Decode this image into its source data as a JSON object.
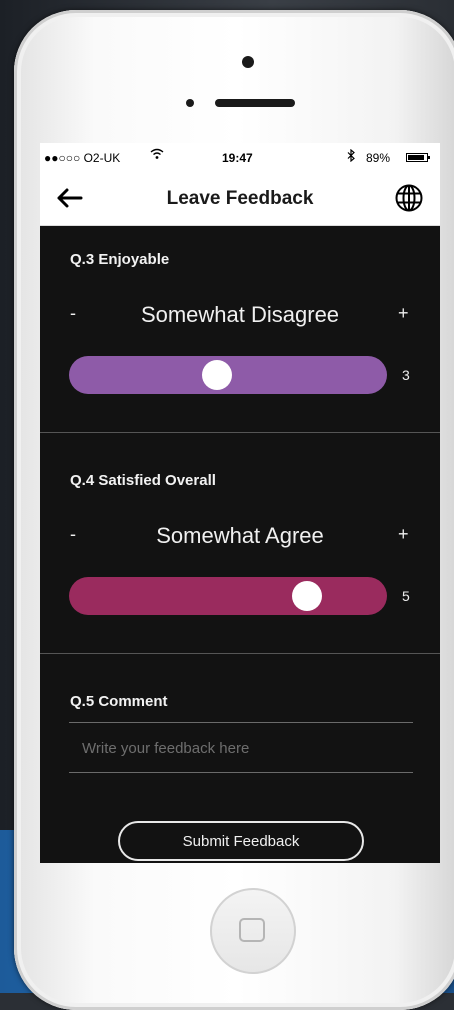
{
  "status_bar": {
    "carrier": "●●○○○ O2-UK",
    "wifi": "wifi-icon",
    "time": "19:47",
    "battery": "89%"
  },
  "nav": {
    "title": "Leave Feedback",
    "back_icon": "back-arrow-icon",
    "language_icon": "globe-icon"
  },
  "questions": [
    {
      "label": "Q.3 Enjoyable",
      "minus": "-",
      "plus": "+",
      "answer": "Somewhat Disagree",
      "value": "3",
      "level": 3,
      "max": 7,
      "color": "#8e5ba8"
    },
    {
      "label": "Q.4 Satisfied Overall",
      "minus": "-",
      "plus": "+",
      "answer": "Somewhat Agree",
      "value": "5",
      "level": 5,
      "max": 7,
      "color": "#9a2b5e"
    }
  ],
  "comment": {
    "label": "Q.5 Comment",
    "placeholder": "Write your feedback here"
  },
  "submit": {
    "label": "Submit Feedback"
  }
}
